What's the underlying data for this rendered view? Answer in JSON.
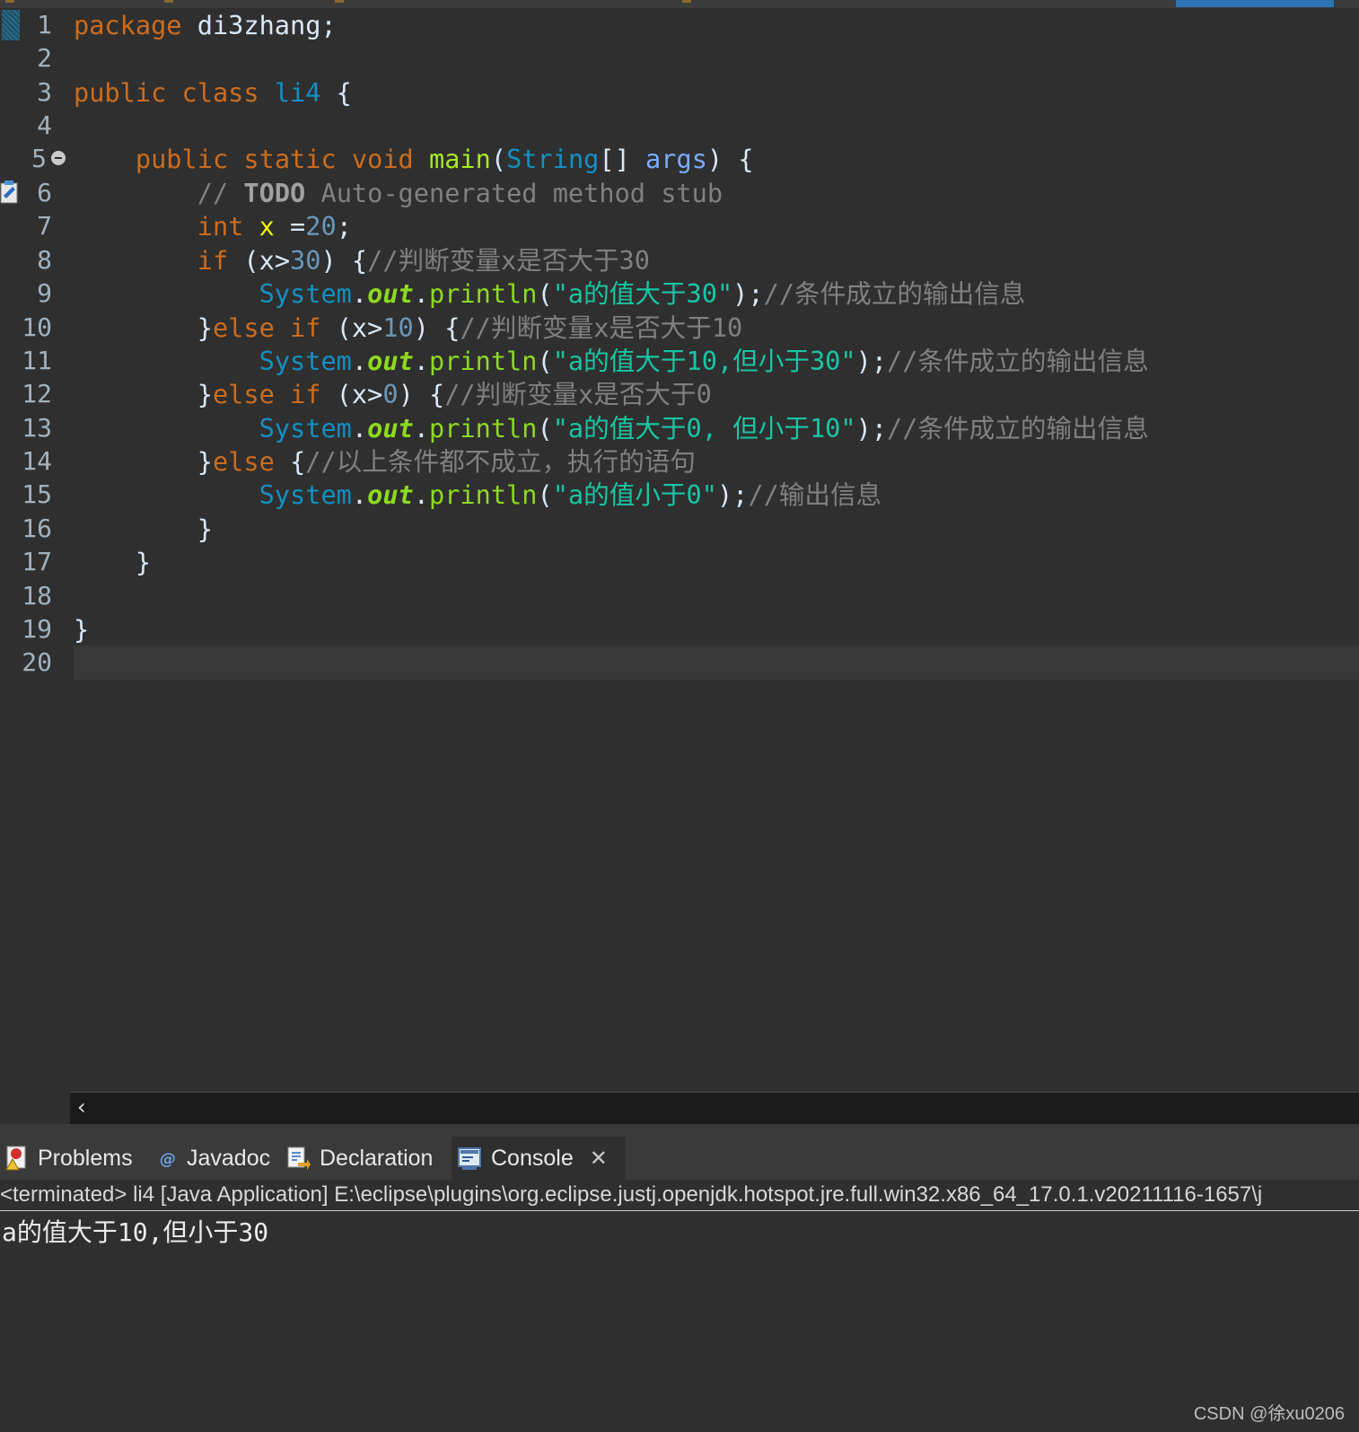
{
  "editor": {
    "line_numbers": [
      "1",
      "2",
      "3",
      "4",
      "5",
      "6",
      "7",
      "8",
      "9",
      "10",
      "11",
      "12",
      "13",
      "14",
      "15",
      "16",
      "17",
      "18",
      "19",
      "20"
    ],
    "code": {
      "l1_kw": "package",
      "l1_rest": " di3zhang;",
      "l3_kw1": "public",
      "l3_kw2": "class",
      "l3_name": "li4",
      "l3_brace": " {",
      "l5_kw1": "public",
      "l5_kw2": "static",
      "l5_kw3": "void",
      "l5_fn": "main",
      "l5_p1": "(",
      "l5_type": "String",
      "l5_p2": "[] ",
      "l5_arg": "args",
      "l5_p3": ") {",
      "l6_cm1": "// ",
      "l6_todo": "TODO",
      "l6_cm2": " Auto-generated method stub",
      "l7_kw": "int",
      "l7_var": "x",
      "l7_eq": " =",
      "l7_num": "20",
      "l7_end": ";",
      "l8_kw": "if",
      "l8_a": " (x>",
      "l8_num": "30",
      "l8_b": ") {",
      "l8_cm": "//判断变量x是否大于30",
      "l9_sys": "System",
      "l9_dot1": ".",
      "l9_out": "out",
      "l9_dot2": ".",
      "l9_fn": "println",
      "l9_p1": "(",
      "l9_str": "\"a的值大于30\"",
      "l9_p2": ");",
      "l9_cm": "//条件成立的输出信息",
      "l10_b": "}",
      "l10_kw": "else if",
      "l10_a": " (x>",
      "l10_num": "10",
      "l10_c": ") {",
      "l10_cm": "//判断变量x是否大于10",
      "l11_sys": "System",
      "l11_dot1": ".",
      "l11_out": "out",
      "l11_dot2": ".",
      "l11_fn": "println",
      "l11_p1": "(",
      "l11_str": "\"a的值大于10,但小于30\"",
      "l11_p2": ");",
      "l11_cm": "//条件成立的输出信息",
      "l12_b": "}",
      "l12_kw": "else if",
      "l12_a": " (x>",
      "l12_num": "0",
      "l12_c": ") {",
      "l12_cm": "//判断变量x是否大于0",
      "l13_sys": "System",
      "l13_dot1": ".",
      "l13_out": "out",
      "l13_dot2": ".",
      "l13_fn": "println",
      "l13_p1": "(",
      "l13_str": "\"a的值大于0, 但小于10\"",
      "l13_p2": ");",
      "l13_cm": "//条件成立的输出信息",
      "l14_b": "}",
      "l14_kw": "else",
      "l14_c": " {",
      "l14_cm": "//以上条件都不成立，执行的语句",
      "l15_sys": "System",
      "l15_dot1": ".",
      "l15_out": "out",
      "l15_dot2": ".",
      "l15_fn": "println",
      "l15_p1": "(",
      "l15_str": "\"a的值小于0\"",
      "l15_p2": ");",
      "l15_cm": "//输出信息",
      "l16": "}",
      "l17": "}",
      "l19": "}"
    },
    "scroll_left_label": "‹"
  },
  "bottom_panel": {
    "tabs": [
      {
        "label": "Problems",
        "icon": "problems-icon"
      },
      {
        "label": "Javadoc",
        "icon": "javadoc-icon"
      },
      {
        "label": "Declaration",
        "icon": "declaration-icon"
      },
      {
        "label": "Console",
        "icon": "console-icon",
        "active": true
      }
    ],
    "close_label": "✕",
    "console_header": "<terminated> li4 [Java Application] E:\\eclipse\\plugins\\org.eclipse.justj.openjdk.hotspot.jre.full.win32.x86_64_17.0.1.v20211116-1657\\j",
    "console_output": "a的值大于10,但小于30"
  },
  "watermark": "CSDN @徐xu0206",
  "colors": {
    "background": "#2f2f2f",
    "keyword": "#cc6c1d",
    "type": "#1290c3",
    "method": "#a7ec21",
    "string": "#17c6a3",
    "comment": "#808080",
    "number": "#6897bb"
  }
}
